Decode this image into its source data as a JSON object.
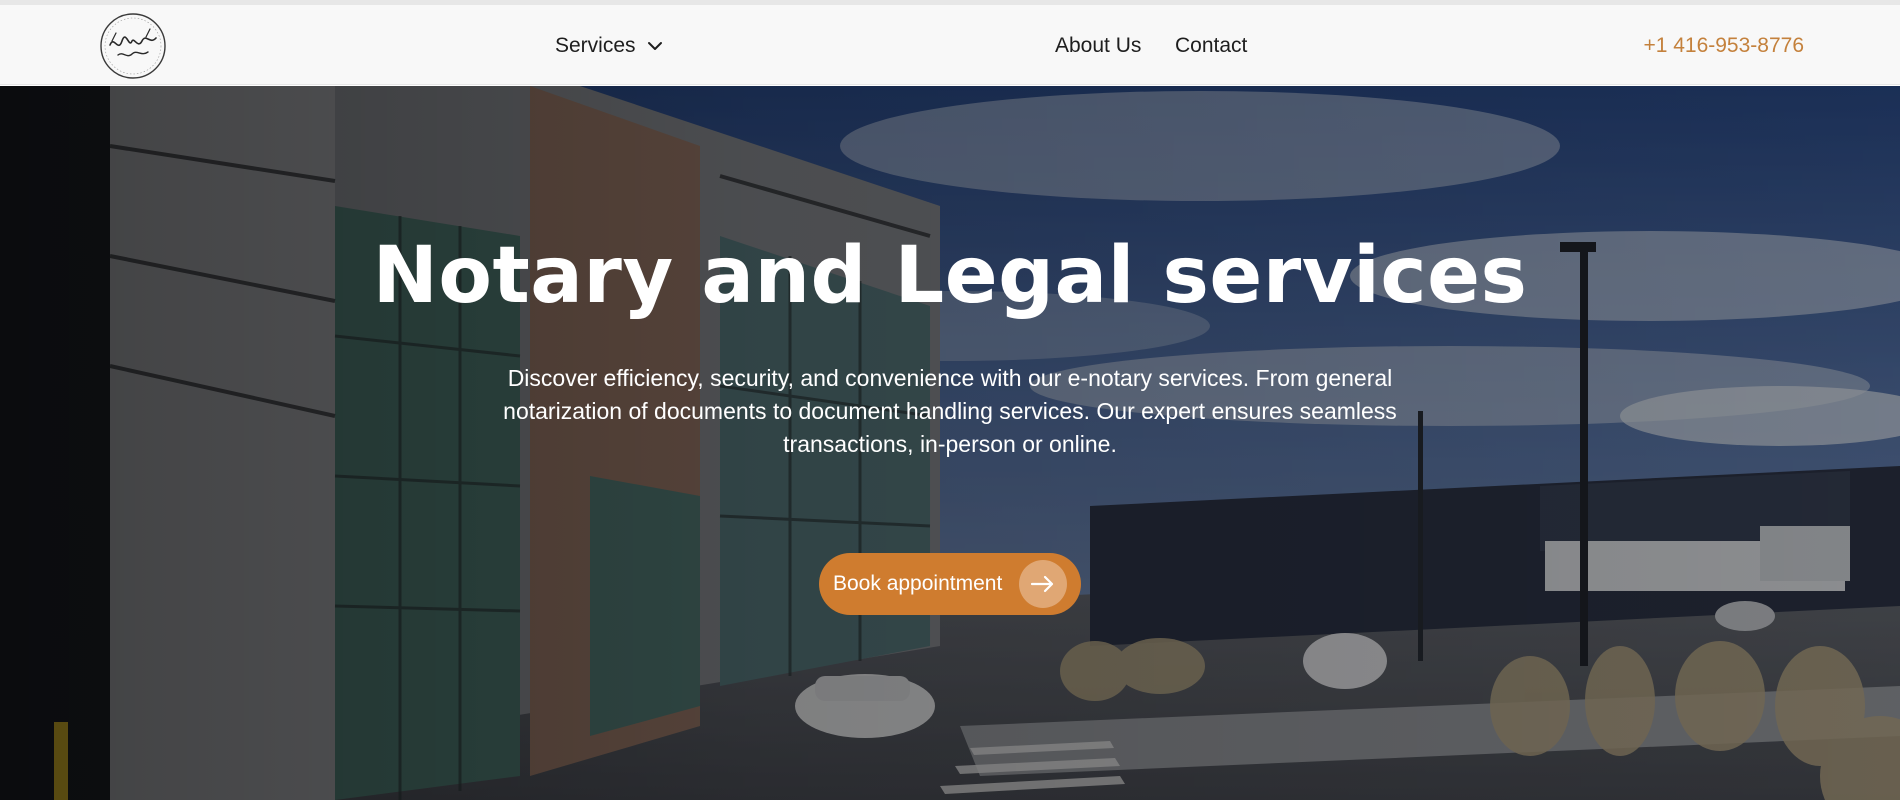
{
  "brand": {
    "logo_icon": "notary-public-signature-logo"
  },
  "nav": {
    "services_label": "Services",
    "services_icon": "chevron-down-icon",
    "about_label": "About Us",
    "contact_label": "Contact",
    "phone": "+1 416-953-8776"
  },
  "hero": {
    "title": "Notary and Legal services",
    "subtitle": "Discover efficiency, security, and convenience with our e-notary services. From general notarization of documents to document handling services. Our expert ensures seamless transactions, in-person or online.",
    "cta_label": "Book appointment",
    "cta_icon": "arrow-right-icon",
    "background": "photo of modern office building and parking lot under blue sky"
  },
  "colors": {
    "accent": "#cf7c2f",
    "phone": "#c4813c",
    "header_bg": "#f8f8f8",
    "text_dark": "#1e1e1e"
  }
}
